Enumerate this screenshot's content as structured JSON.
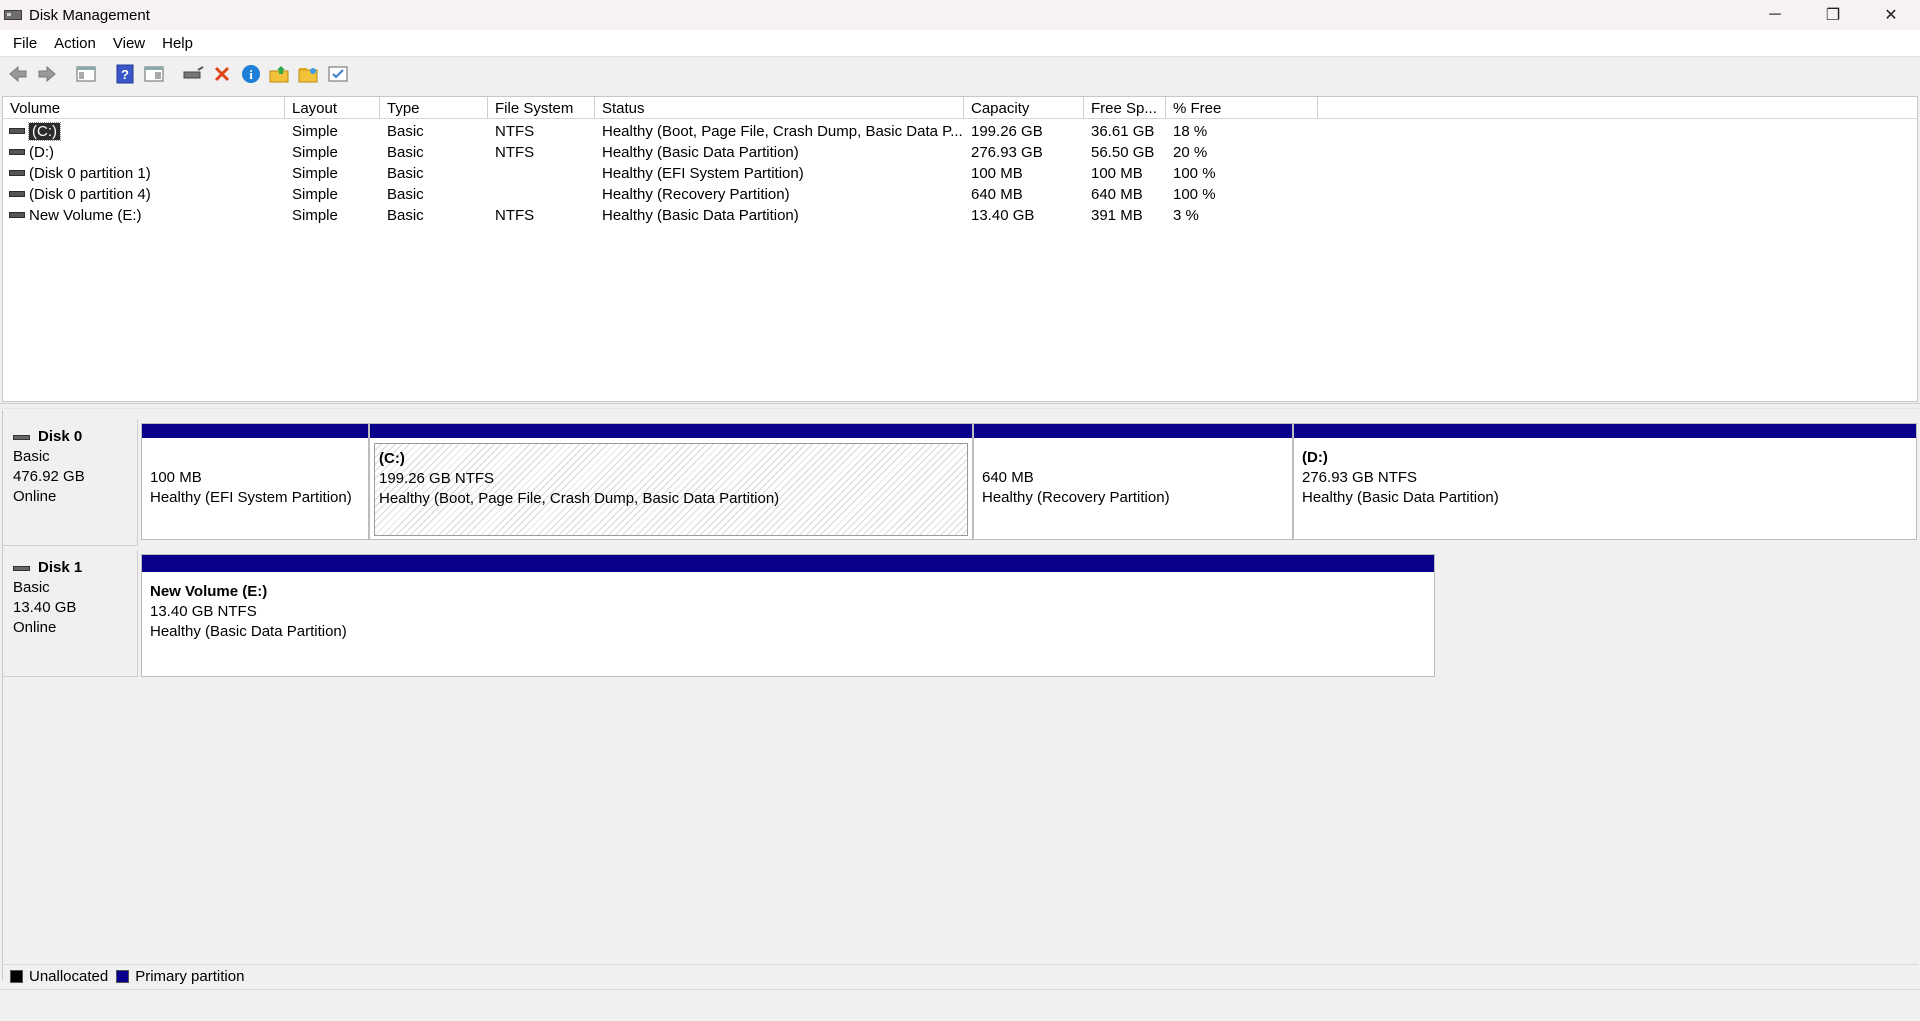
{
  "window": {
    "title": "Disk Management",
    "minimize_glyph": "─",
    "restore_glyph": "❐",
    "close_glyph": "✕"
  },
  "menu": [
    "File",
    "Action",
    "View",
    "Help"
  ],
  "toolbar": {
    "icons": [
      "back-arrow-icon",
      "forward-arrow-icon",
      "show-hide-console-tree-icon",
      "help-icon",
      "properties-pane-icon",
      "connect-drive-icon",
      "delete-icon",
      "properties-icon",
      "open-folder-icon",
      "explore-folder-icon",
      "checklist-icon"
    ]
  },
  "volume_list": {
    "headers": [
      "Volume",
      "Layout",
      "Type",
      "File System",
      "Status",
      "Capacity",
      "Free Sp...",
      "% Free"
    ],
    "rows": [
      {
        "volume": "(C:)",
        "layout": "Simple",
        "type": "Basic",
        "fs": "NTFS",
        "status": "Healthy (Boot, Page File, Crash Dump, Basic Data P...",
        "capacity": "199.26 GB",
        "free": "36.61 GB",
        "pct": "18 %"
      },
      {
        "volume": "(D:)",
        "layout": "Simple",
        "type": "Basic",
        "fs": "NTFS",
        "status": "Healthy (Basic Data Partition)",
        "capacity": "276.93 GB",
        "free": "56.50 GB",
        "pct": "20 %"
      },
      {
        "volume": "(Disk 0 partition 1)",
        "layout": "Simple",
        "type": "Basic",
        "fs": "",
        "status": "Healthy (EFI System Partition)",
        "capacity": "100 MB",
        "free": "100 MB",
        "pct": "100 %"
      },
      {
        "volume": "(Disk 0 partition 4)",
        "layout": "Simple",
        "type": "Basic",
        "fs": "",
        "status": "Healthy (Recovery Partition)",
        "capacity": "640 MB",
        "free": "640 MB",
        "pct": "100 %"
      },
      {
        "volume": "New Volume (E:)",
        "layout": "Simple",
        "type": "Basic",
        "fs": "NTFS",
        "status": "Healthy (Basic Data Partition)",
        "capacity": "13.40 GB",
        "free": "391 MB",
        "pct": "3 %"
      }
    ]
  },
  "disks": [
    {
      "name": "Disk 0",
      "type": "Basic",
      "size": "476.92 GB",
      "state": "Online",
      "partitions": [
        {
          "name": "",
          "size": "100 MB",
          "status": "Healthy (EFI System Partition)"
        },
        {
          "name": "(C:)",
          "size": "199.26 GB NTFS",
          "status": "Healthy (Boot, Page File, Crash Dump, Basic Data Partition)"
        },
        {
          "name": "",
          "size": "640 MB",
          "status": "Healthy (Recovery Partition)"
        },
        {
          "name": "(D:)",
          "size": "276.93 GB NTFS",
          "status": "Healthy (Basic Data Partition)"
        }
      ]
    },
    {
      "name": "Disk 1",
      "type": "Basic",
      "size": "13.40 GB",
      "state": "Online",
      "partitions": [
        {
          "name": "New Volume  (E:)",
          "size": "13.40 GB NTFS",
          "status": "Healthy (Basic Data Partition)"
        }
      ]
    }
  ],
  "legend": [
    {
      "label": "Unallocated",
      "color": "#000000"
    },
    {
      "label": "Primary partition",
      "color": "#08008c"
    }
  ],
  "colors": {
    "primary_partition": "#08008c",
    "selection": "#2b2b2b"
  }
}
